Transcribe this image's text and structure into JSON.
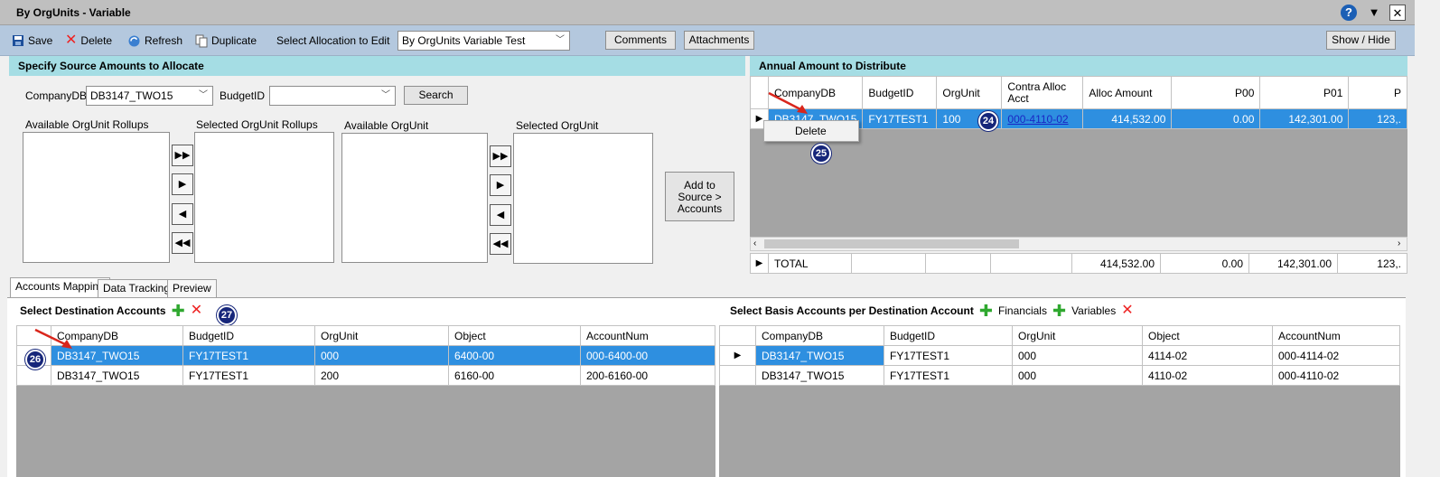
{
  "window": {
    "title": "By OrgUnits - Variable",
    "help_icon": "?",
    "minimize_icon": "▼",
    "close_icon": "✕"
  },
  "toolbar": {
    "save": "Save",
    "delete": "Delete",
    "refresh": "Refresh",
    "duplicate": "Duplicate",
    "select_label": "Select Allocation to Edit",
    "selected_allocation": "By OrgUnits Variable Test",
    "comments": "Comments",
    "attachments": "Attachments",
    "show_hide": "Show / Hide"
  },
  "source": {
    "header": "Specify Source Amounts to Allocate",
    "company_label": "CompanyDB",
    "company_value": "DB3147_TWO15",
    "budget_label": "BudgetID",
    "budget_value": "",
    "search": "Search",
    "available_rollups": "Available OrgUnit Rollups",
    "selected_rollups": "Selected OrgUnit Rollups",
    "available_orgunit": "Available OrgUnit",
    "selected_orgunit": "Selected OrgUnit",
    "add_to_source": "Add to Source > Accounts"
  },
  "annual": {
    "header": "Annual Amount to Distribute",
    "columns": [
      "CompanyDB",
      "BudgetID",
      "OrgUnit",
      "Contra Alloc Acct",
      "Alloc Amount",
      "P00",
      "P01",
      "P"
    ],
    "row": {
      "company": "DB3147_TWO15",
      "budget": "FY17TEST1",
      "orgunit": "100",
      "contra": "000-4110-02",
      "alloc": "414,532.00",
      "p00": "0.00",
      "p01": "142,301.00",
      "p02": "123,."
    },
    "context_menu": "Delete",
    "total": {
      "label": "TOTAL",
      "alloc": "414,532.00",
      "p00": "0.00",
      "p01": "142,301.00",
      "p02": "123,."
    }
  },
  "tabs": [
    "Accounts Mapping",
    "Data Tracking",
    "Preview"
  ],
  "destination": {
    "header": "Select Destination Accounts",
    "columns": [
      "CompanyDB",
      "BudgetID",
      "OrgUnit",
      "Object",
      "AccountNum"
    ],
    "rows": [
      {
        "company": "DB3147_TWO15",
        "budget": "FY17TEST1",
        "orgunit": "000",
        "object": "6400-00",
        "account": "000-6400-00"
      },
      {
        "company": "DB3147_TWO15",
        "budget": "FY17TEST1",
        "orgunit": "200",
        "object": "6160-00",
        "account": "200-6160-00"
      }
    ]
  },
  "basis": {
    "header": "Select Basis Accounts per Destination Account",
    "financials": "Financials",
    "variables": "Variables",
    "columns": [
      "CompanyDB",
      "BudgetID",
      "OrgUnit",
      "Object",
      "AccountNum"
    ],
    "rows": [
      {
        "company": "DB3147_TWO15",
        "budget": "FY17TEST1",
        "orgunit": "000",
        "object": "4114-02",
        "account": "000-4114-02"
      },
      {
        "company": "DB3147_TWO15",
        "budget": "FY17TEST1",
        "orgunit": "000",
        "object": "4110-02",
        "account": "000-4110-02"
      }
    ]
  },
  "badges": [
    "24",
    "25",
    "26",
    "27"
  ],
  "colors": {
    "selection": "#2e8fe0",
    "toolbar": "#b4c8de",
    "section_header": "#a5dde4",
    "badge": "#16267a"
  }
}
